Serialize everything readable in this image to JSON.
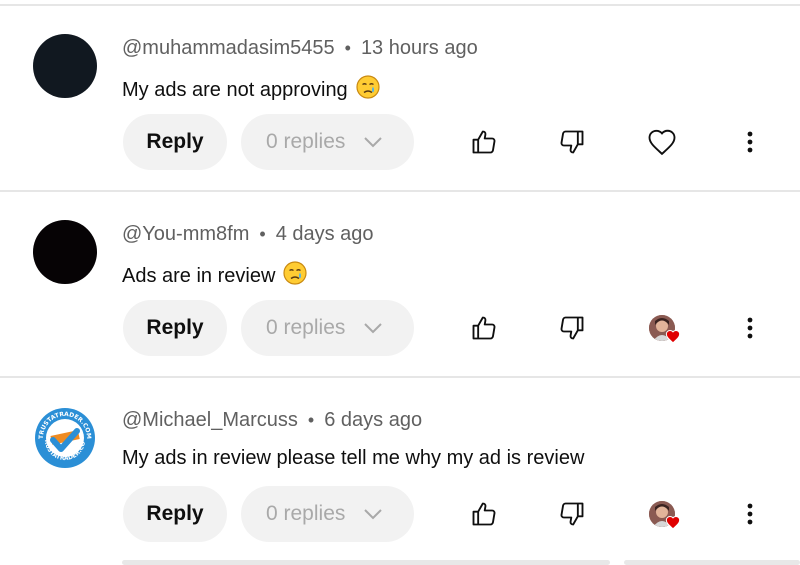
{
  "comments": [
    {
      "handle": "@muhammadasim5455",
      "separator": "•",
      "time": "13 hours ago",
      "text": "My ads are not approving",
      "emoji": "crying-face",
      "reply_label": "Reply",
      "replies_label": "0 replies",
      "hearted_by_creator": false
    },
    {
      "handle": "@You-mm8fm",
      "separator": "•",
      "time": "4 days ago",
      "text": "Ads are in review",
      "emoji": "crying-face",
      "reply_label": "Reply",
      "replies_label": "0 replies",
      "hearted_by_creator": true
    },
    {
      "handle": "@Michael_Marcuss",
      "separator": "•",
      "time": "6 days ago",
      "text": "My ads in review please tell me why my ad is review",
      "emoji": "",
      "reply_label": "Reply",
      "replies_label": "0 replies",
      "hearted_by_creator": true
    }
  ],
  "logo_text": "TRUSTATRADER.COM",
  "colors": {
    "meta": "#606060",
    "button_bg": "#f2f2f2",
    "replies_text": "#a9a9a9",
    "heart_badge": "#e00000",
    "logo_blue": "#2b8fd6",
    "logo_orange": "#ef8b22"
  }
}
